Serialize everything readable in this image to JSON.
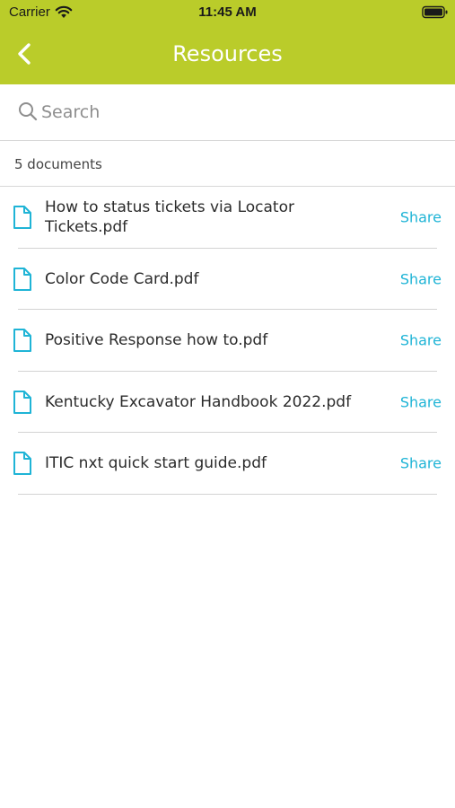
{
  "status_bar": {
    "carrier": "Carrier",
    "time": "11:45 AM"
  },
  "header": {
    "title": "Resources",
    "back_icon": "chevron-left-icon"
  },
  "search": {
    "placeholder": "Search",
    "value": ""
  },
  "documents": {
    "count_label": "5 documents",
    "items": [
      {
        "name": "How to status tickets via Locator Tickets.pdf",
        "action": "Share"
      },
      {
        "name": "Color Code Card.pdf",
        "action": "Share"
      },
      {
        "name": "Positive Response how to.pdf",
        "action": "Share"
      },
      {
        "name": "Kentucky Excavator Handbook 2022.pdf",
        "action": "Share"
      },
      {
        "name": "ITIC nxt quick start guide.pdf",
        "action": "Share"
      }
    ]
  },
  "colors": {
    "header_bg": "#bacc2a",
    "accent": "#1fb4d6",
    "divider": "#d3d3d3"
  }
}
